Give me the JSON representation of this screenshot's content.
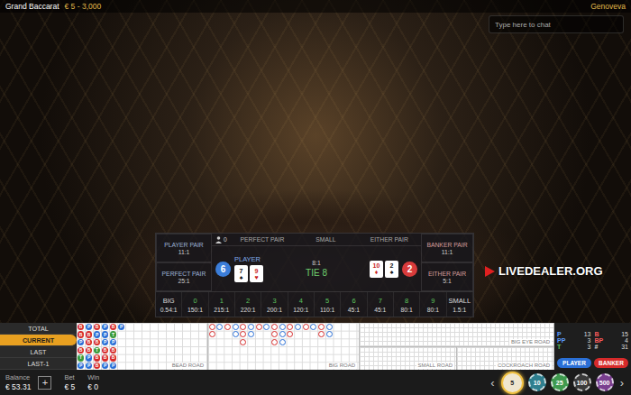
{
  "window": {
    "title": "Grand Baccarat",
    "limits": "€ 5 - 3,000"
  },
  "dealer": "Genoveva",
  "chat": {
    "placeholder": "Type here to chat"
  },
  "watermark": "LIVEDEALER.ORG",
  "side_bets": {
    "left": [
      {
        "label": "PLAYER PAIR",
        "odds": "11:1"
      },
      {
        "label": "PERFECT PAIR",
        "odds": "25:1"
      }
    ],
    "right": [
      {
        "label": "BANKER PAIR",
        "odds": "11:1"
      },
      {
        "label": "EITHER PAIR",
        "odds": "5:1"
      }
    ],
    "headers": [
      "PERFECT PAIR",
      "SMALL",
      "EITHER PAIR"
    ]
  },
  "player_count": "0",
  "result": {
    "player": {
      "label": "PLAYER",
      "score": "6",
      "cards": [
        {
          "rank": "7",
          "suit": "♠",
          "color": "#111111"
        },
        {
          "rank": "9",
          "suit": "♥",
          "color": "#c81e1e"
        }
      ]
    },
    "tie": {
      "label": "TIE 8",
      "odds": "8:1"
    },
    "banker": {
      "score": "2",
      "cards": [
        {
          "rank": "10",
          "suit": "♦",
          "color": "#c81e1e"
        },
        {
          "rank": "2",
          "suit": "♠",
          "color": "#111111"
        }
      ]
    }
  },
  "payouts": [
    {
      "label": "BIG",
      "odds": "0.54:1"
    },
    {
      "label": "0",
      "odds": "150:1"
    },
    {
      "label": "1",
      "odds": "215:1"
    },
    {
      "label": "2",
      "odds": "220:1"
    },
    {
      "label": "3",
      "odds": "200:1"
    },
    {
      "label": "4",
      "odds": "120:1"
    },
    {
      "label": "5",
      "odds": "110:1"
    },
    {
      "label": "6",
      "odds": "45:1"
    },
    {
      "label": "7",
      "odds": "45:1"
    },
    {
      "label": "8",
      "odds": "80:1"
    },
    {
      "label": "9",
      "odds": "80:1"
    },
    {
      "label": "SMALL",
      "odds": "1.5:1"
    }
  ],
  "history_tabs": [
    {
      "label": "TOTAL",
      "selected": false
    },
    {
      "label": "CURRENT",
      "selected": true
    },
    {
      "label": "LAST",
      "selected": false
    },
    {
      "label": "LAST-1",
      "selected": false
    }
  ],
  "bead_road": [
    {
      "result": "B"
    },
    {
      "result": "B"
    },
    {
      "result": "P"
    },
    {
      "result": "B"
    },
    {
      "result": "T"
    },
    {
      "result": "P"
    },
    {
      "result": "P"
    },
    {
      "result": "B"
    },
    {
      "result": "B"
    },
    {
      "result": "B"
    },
    {
      "result": "P"
    },
    {
      "result": "P"
    },
    {
      "result": "B"
    },
    {
      "result": "P"
    },
    {
      "result": "B"
    },
    {
      "result": "T"
    },
    {
      "result": "B"
    },
    {
      "result": "B"
    },
    {
      "result": "P"
    },
    {
      "result": "P"
    },
    {
      "result": "P"
    },
    {
      "result": "B"
    },
    {
      "result": "B"
    },
    {
      "result": "P"
    },
    {
      "result": "B"
    },
    {
      "result": "T"
    },
    {
      "result": "P"
    },
    {
      "result": "B"
    },
    {
      "result": "B"
    },
    {
      "result": "P"
    },
    {
      "result": "P"
    }
  ],
  "road_labels": {
    "bead": "BEAD ROAD",
    "big": "BIG ROAD",
    "big_eye": "BIG EYE ROAD",
    "small": "SMALL ROAD",
    "cockroach": "COCKROACH ROAD"
  },
  "stats": [
    {
      "label": "P",
      "value": "13",
      "color": "#5b9bff"
    },
    {
      "label": "B",
      "value": "15",
      "color": "#ff5b5b"
    },
    {
      "label": "PP",
      "value": "3",
      "color": "#5b9bff"
    },
    {
      "label": "BP",
      "value": "4",
      "color": "#ff5b5b"
    },
    {
      "label": "T",
      "value": "3",
      "color": "#5ec45e"
    },
    {
      "label": "#",
      "value": "31",
      "color": "#dddddd"
    }
  ],
  "bet_buttons": [
    {
      "label": "PLAYER",
      "color": "#2a6fd6"
    },
    {
      "label": "BANKER",
      "color": "#d62a2a"
    }
  ],
  "footer": {
    "balance_label": "Balance",
    "balance": "€ 53.31",
    "add": "+",
    "bet_label": "Bet",
    "bet": "€ 5",
    "win_label": "Win",
    "win": "€ 0"
  },
  "chip_prev": "‹",
  "chip_next": "›",
  "chips": [
    {
      "value": "5",
      "selected": true,
      "color": "#efe6cf"
    },
    {
      "value": "10",
      "selected": false,
      "color": "#2f7f8f"
    },
    {
      "value": "25",
      "selected": false,
      "color": "#3f9a4f"
    },
    {
      "value": "100",
      "selected": false,
      "color": "#3a3a3a"
    },
    {
      "value": "500",
      "selected": false,
      "color": "#7a3f8f"
    }
  ]
}
